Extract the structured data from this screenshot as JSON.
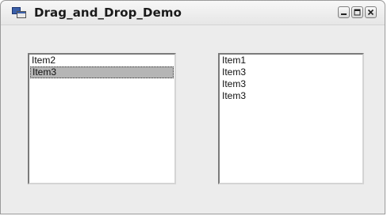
{
  "window": {
    "title": "Drag_and_Drop_Demo",
    "controls": [
      "minimize-icon",
      "maximize-icon",
      "close-icon"
    ]
  },
  "left_list": {
    "items": [
      {
        "label": "Item2",
        "selected": false
      },
      {
        "label": "Item3",
        "selected": true
      }
    ]
  },
  "right_list": {
    "items": [
      {
        "label": "Item1"
      },
      {
        "label": "Item3"
      },
      {
        "label": "Item3"
      },
      {
        "label": "Item3"
      }
    ]
  },
  "colors": {
    "selection": "#b5b5b5",
    "window_bg": "#ececec",
    "list_bg": "#ffffff"
  }
}
